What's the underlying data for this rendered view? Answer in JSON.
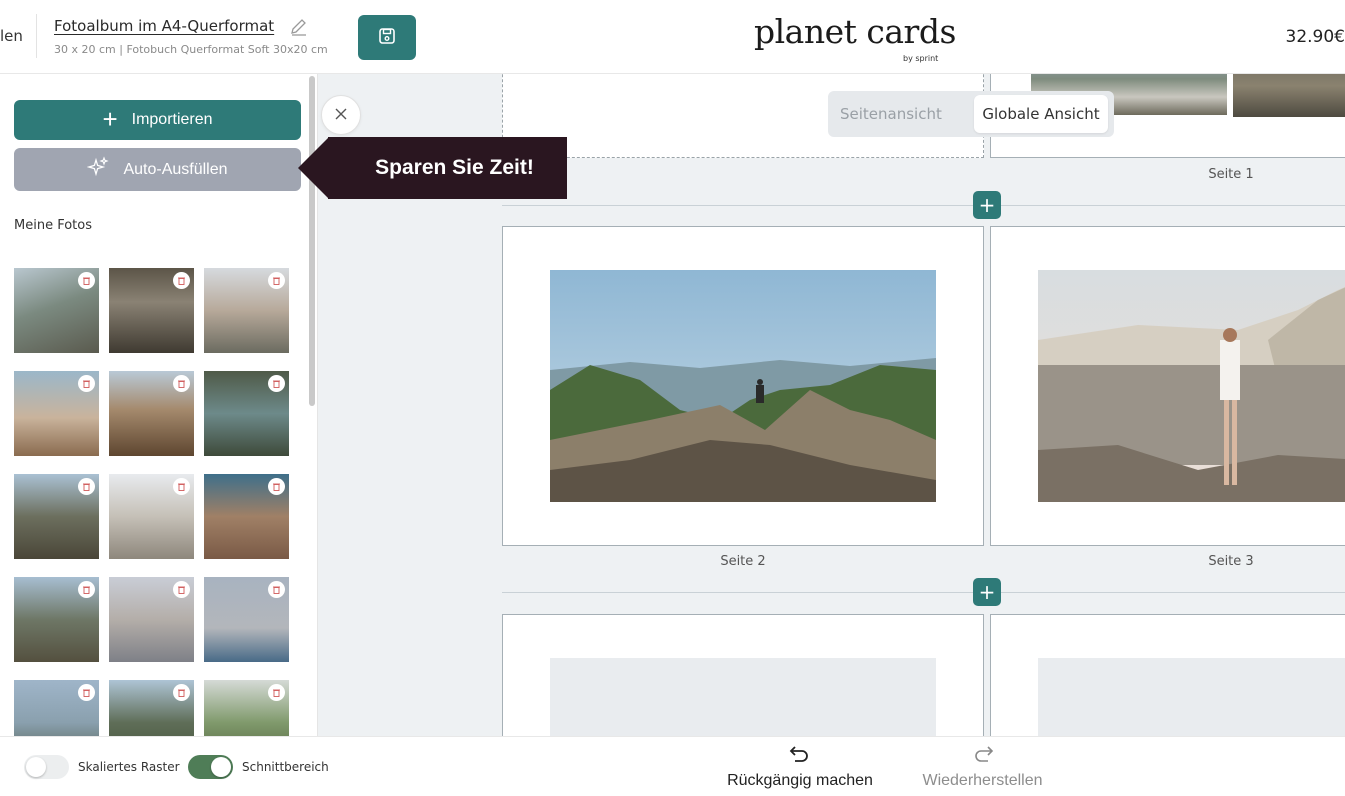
{
  "header": {
    "back_label_fragment": "len",
    "album_title": "Fotoalbum im A4-Querformat",
    "album_subtitle": "30 x 20 cm | Fotobuch Querformat Soft 30x20 cm",
    "logo": "planet cards",
    "logo_by": "by sprint",
    "price": "32.90€"
  },
  "sidebar": {
    "import_label": "Importieren",
    "autofill_label": "Auto-Ausfüllen",
    "my_photos_label": "Meine Fotos"
  },
  "tooltip": {
    "text": "Sparen Sie Zeit!"
  },
  "canvas": {
    "view_toggle": {
      "page_view": "Seitenansicht",
      "global_view": "Globale Ansicht",
      "active": "global_view"
    },
    "pages": [
      {
        "label": "Seite 1"
      },
      {
        "label": "Seite 2"
      },
      {
        "label": "Seite 3"
      }
    ]
  },
  "bottom": {
    "scaled_grid_label": "Skaliertes Raster",
    "scaled_grid_on": false,
    "cut_area_label": "Schnittbereich",
    "cut_area_on": true,
    "undo_label": "Rückgängig machen",
    "redo_label": "Wiederherstellen"
  },
  "colors": {
    "primary": "#2e7a78",
    "autofill": "#a0a5b1",
    "tooltip": "#2a1620",
    "toggle_on": "#4f7d57",
    "canvas_bg": "#eef1f3"
  }
}
